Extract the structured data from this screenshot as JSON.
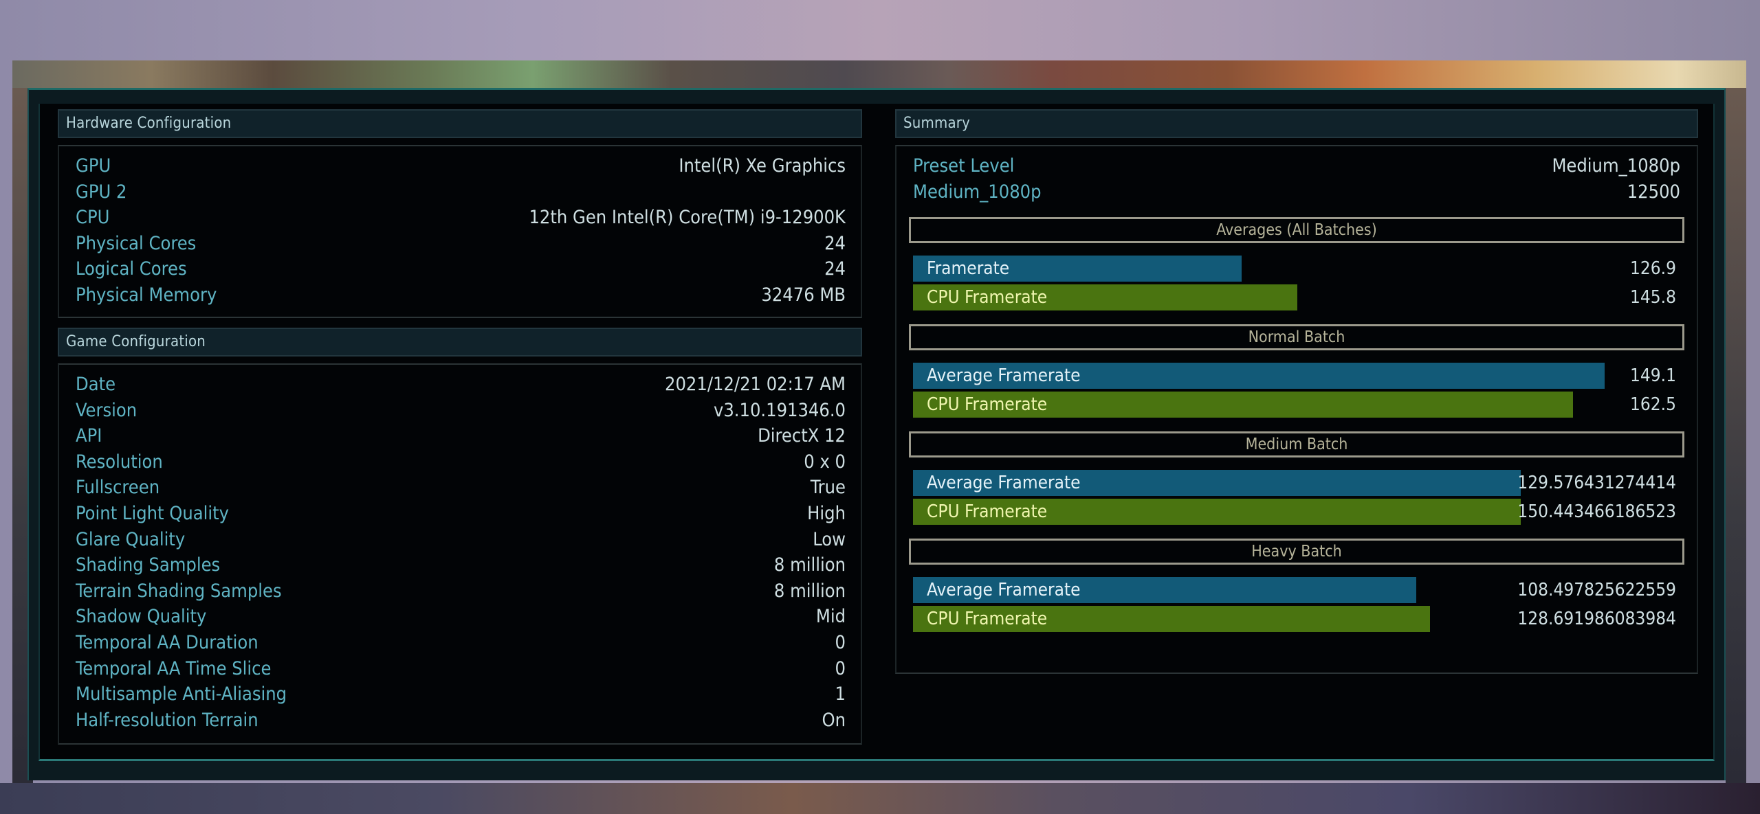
{
  "hardware": {
    "title": "Hardware Configuration",
    "rows": [
      {
        "key": "GPU",
        "value": "Intel(R) Xe Graphics"
      },
      {
        "key": "GPU 2",
        "value": ""
      },
      {
        "key": "CPU",
        "value": "12th Gen Intel(R) Core(TM) i9-12900K"
      },
      {
        "key": "Physical Cores",
        "value": "24"
      },
      {
        "key": "Logical Cores",
        "value": "24"
      },
      {
        "key": "Physical Memory",
        "value": "32476 MB"
      }
    ]
  },
  "game": {
    "title": "Game Configuration",
    "rows": [
      {
        "key": "Date",
        "value": "2021/12/21 02:17 AM"
      },
      {
        "key": "Version",
        "value": "v3.10.191346.0"
      },
      {
        "key": "API",
        "value": "DirectX 12"
      },
      {
        "key": "Resolution",
        "value": "0 x 0"
      },
      {
        "key": "Fullscreen",
        "value": "True"
      },
      {
        "key": "Point Light Quality",
        "value": "High"
      },
      {
        "key": "Glare Quality",
        "value": "Low"
      },
      {
        "key": "Shading Samples",
        "value": "8 million"
      },
      {
        "key": "Terrain Shading Samples",
        "value": "8 million"
      },
      {
        "key": "Shadow Quality",
        "value": "Mid"
      },
      {
        "key": "Temporal AA Duration",
        "value": "0"
      },
      {
        "key": "Temporal AA Time Slice",
        "value": "0"
      },
      {
        "key": "Multisample Anti-Aliasing",
        "value": "1"
      },
      {
        "key": "Half-resolution Terrain",
        "value": "On"
      }
    ]
  },
  "summary": {
    "title": "Summary",
    "rows": [
      {
        "key": "Preset Level",
        "value": "Medium_1080p"
      },
      {
        "key": "Medium_1080p",
        "value": "12500"
      }
    ],
    "batches": [
      {
        "title": "Averages (All Batches)",
        "bars": [
          {
            "label": "Framerate",
            "value": "126.9",
            "kind": "gpu",
            "fill": 0.47
          },
          {
            "label": "CPU Framerate",
            "value": "145.8",
            "kind": "cpu",
            "fill": 0.55
          }
        ]
      },
      {
        "title": "Normal Batch",
        "bars": [
          {
            "label": "Average Framerate",
            "value": "149.1",
            "kind": "gpu",
            "fill": 0.99
          },
          {
            "label": "CPU Framerate",
            "value": "162.5",
            "kind": "cpu",
            "fill": 0.945
          }
        ]
      },
      {
        "title": "Medium Batch",
        "bars": [
          {
            "label": "Average Framerate",
            "value": "129.576431274414",
            "kind": "gpu",
            "fill": 0.87
          },
          {
            "label": "CPU Framerate",
            "value": "150.443466186523",
            "kind": "cpu",
            "fill": 0.87
          }
        ]
      },
      {
        "title": "Heavy Batch",
        "bars": [
          {
            "label": "Average Framerate",
            "value": "108.497825622559",
            "kind": "gpu",
            "fill": 0.72
          },
          {
            "label": "CPU Framerate",
            "value": "128.691986083984",
            "kind": "cpu",
            "fill": 0.74
          }
        ]
      }
    ]
  },
  "colors": {
    "gpu_bar": "#125a78",
    "cpu_bar": "#4a7410",
    "key_text": "#5fb4c4",
    "value_text": "#cfdfe2",
    "batch_title": "#b6b49a"
  }
}
